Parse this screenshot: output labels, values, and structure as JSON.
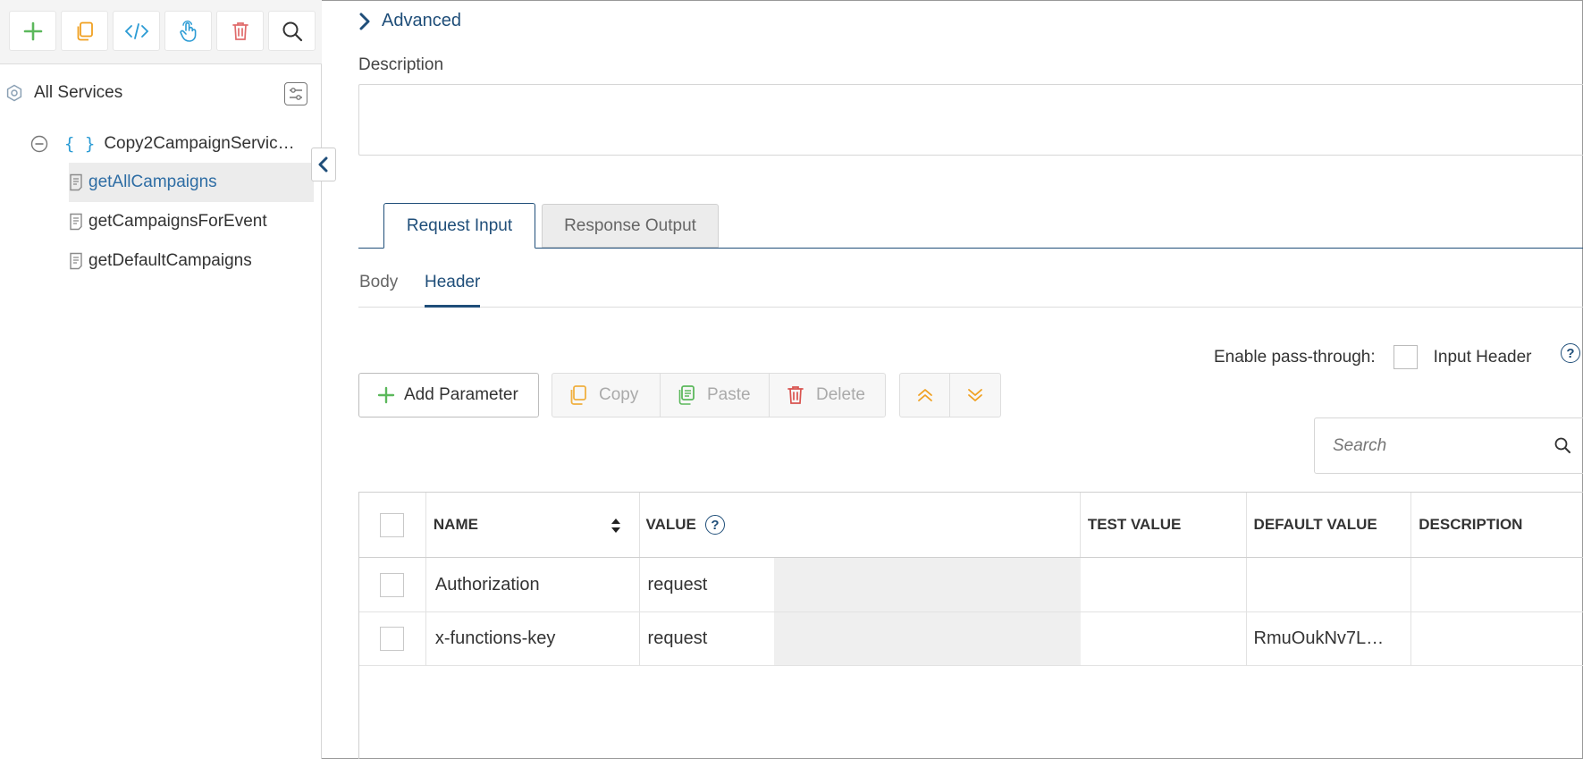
{
  "sidebar": {
    "toolbar": [
      {
        "icon": "plus-icon",
        "color": "#5cb85c"
      },
      {
        "icon": "copy-icon",
        "color": "#f0a020"
      },
      {
        "icon": "code-icon",
        "color": "#2b9bd4"
      },
      {
        "icon": "touch-icon",
        "color": "#2b9bd4"
      },
      {
        "icon": "trash-icon",
        "color": "#e06b6b"
      },
      {
        "icon": "search-icon",
        "color": "#333333"
      }
    ],
    "root_label": "All Services",
    "service": {
      "braces": "{ }",
      "name": "Copy2CampaignServic…"
    },
    "operations": [
      {
        "label": "getAllCampaigns",
        "selected": true
      },
      {
        "label": "getCampaignsForEvent",
        "selected": false
      },
      {
        "label": "getDefaultCampaigns",
        "selected": false
      }
    ]
  },
  "main": {
    "advanced_label": "Advanced",
    "description_label": "Description",
    "description_value": "",
    "tabs": [
      {
        "label": "Request Input",
        "active": true
      },
      {
        "label": "Response Output",
        "active": false
      }
    ],
    "subtabs": [
      {
        "label": "Body",
        "active": false
      },
      {
        "label": "Header",
        "active": true
      }
    ],
    "pass_through": {
      "label": "Enable pass-through:",
      "checkbox_label": "Input Header",
      "checked": false,
      "help": "?"
    },
    "actions": {
      "add": "Add Parameter",
      "copy": "Copy",
      "paste": "Paste",
      "delete": "Delete"
    },
    "search": {
      "placeholder": "Search",
      "value": ""
    },
    "table": {
      "columns": [
        "NAME",
        "VALUE",
        "TEST VALUE",
        "DEFAULT VALUE",
        "DESCRIPTION"
      ],
      "value_help": "?",
      "rows": [
        {
          "name": "Authorization",
          "value": "request",
          "test_value": "",
          "default_value": "",
          "description": ""
        },
        {
          "name": "x-functions-key",
          "value": "request",
          "test_value": "",
          "default_value": "RmuOukNv7L…",
          "description": ""
        }
      ]
    }
  },
  "colors": {
    "accent": "#1f4e79",
    "selected_row_bg": "#ececec",
    "link_selected": "#2e6da4"
  }
}
